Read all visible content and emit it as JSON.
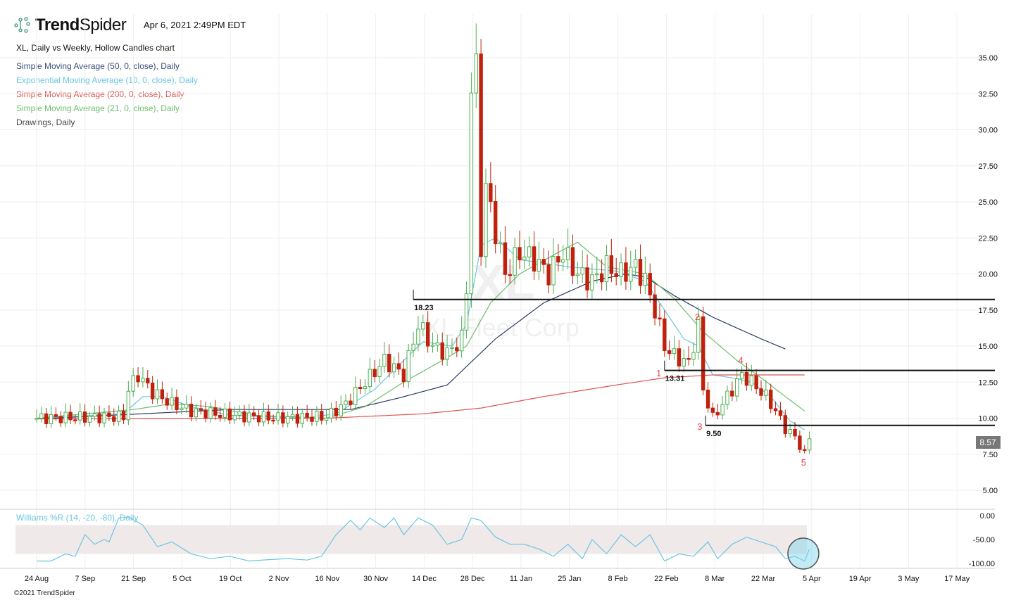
{
  "header": {
    "brand_bold": "Trend",
    "brand_light": "Spider",
    "timestamp": "Apr 6, 2021 2:49PM EDT",
    "chart_title": "XL, Daily vs Weekly, Hollow Candles chart",
    "footer": "©2021 TrendSpider"
  },
  "legend": [
    {
      "label": "Simple Moving Average (50, 0, close), Daily",
      "color": "#3a4f7a"
    },
    {
      "label": "Exponential Moving Average (10, 0, close), Daily",
      "color": "#6cc6e0"
    },
    {
      "label": "Simple Moving Average (200, 0, close), Daily",
      "color": "#d9534f"
    },
    {
      "label": "Simple Moving Average (21, 0, close), Daily",
      "color": "#6cbf6c"
    },
    {
      "label": "Drawings, Daily",
      "color": "#444444"
    }
  ],
  "watermark": {
    "symbol": "XL",
    "name": "XL Fleet Corp"
  },
  "chart_data": {
    "type": "candlestick",
    "ylim": [
      5,
      35
    ],
    "yticks": [
      "35.00",
      "32.50",
      "30.00",
      "27.50",
      "25.00",
      "22.50",
      "20.00",
      "17.50",
      "15.00",
      "12.50",
      "10.00",
      "7.50",
      "5.00"
    ],
    "xticks": [
      "24 Aug",
      "7 Sep",
      "21 Sep",
      "5 Oct",
      "19 Oct",
      "2 Nov",
      "16 Nov",
      "30 Nov",
      "14 Dec",
      "28 Dec",
      "11 Jan",
      "25 Jan",
      "8 Feb",
      "22 Feb",
      "8 Mar",
      "22 Mar",
      "5 Apr",
      "19 Apr",
      "3 May",
      "17 May"
    ],
    "last_price": "8.57",
    "close_path": [
      [
        0,
        10
      ],
      [
        18,
        10.1
      ],
      [
        19,
        12
      ],
      [
        21,
        13
      ],
      [
        24,
        11.8
      ],
      [
        28,
        11
      ],
      [
        32,
        10.5
      ],
      [
        40,
        10.2
      ],
      [
        50,
        10
      ],
      [
        60,
        10.1
      ],
      [
        64,
        11
      ],
      [
        68,
        12.5
      ],
      [
        72,
        14
      ],
      [
        76,
        13
      ],
      [
        79,
        16.5
      ],
      [
        82,
        15
      ],
      [
        85,
        14.5
      ],
      [
        88,
        15.5
      ],
      [
        89,
        19
      ],
      [
        90,
        33
      ],
      [
        91,
        34
      ],
      [
        92,
        22
      ],
      [
        93,
        26
      ],
      [
        95,
        23
      ],
      [
        97,
        20
      ],
      [
        100,
        21.5
      ],
      [
        103,
        21
      ],
      [
        106,
        20
      ],
      [
        109,
        21.5
      ],
      [
        112,
        20
      ],
      [
        115,
        19.5
      ],
      [
        118,
        20.5
      ],
      [
        121,
        20
      ],
      [
        124,
        20.5
      ],
      [
        126,
        19.5
      ],
      [
        128,
        17.5
      ],
      [
        130,
        15
      ],
      [
        132,
        14.3
      ],
      [
        135,
        13.8
      ],
      [
        137,
        16.5
      ],
      [
        138,
        12
      ],
      [
        140,
        10
      ],
      [
        143,
        11.5
      ],
      [
        146,
        13
      ],
      [
        148,
        12.5
      ],
      [
        151,
        11.5
      ],
      [
        153,
        10.5
      ],
      [
        155,
        9.3
      ],
      [
        157,
        8.7
      ],
      [
        159,
        7.5
      ],
      [
        160,
        8.57
      ]
    ],
    "series": [
      {
        "name": "SMA 50",
        "color": "#2a3a66",
        "points": [
          [
            0,
            9.95
          ],
          [
            40,
            10.6
          ],
          [
            65,
            10.6
          ],
          [
            75,
            11.4
          ],
          [
            85,
            12.3
          ],
          [
            95,
            15.5
          ],
          [
            105,
            18
          ],
          [
            115,
            19.5
          ],
          [
            122,
            20
          ],
          [
            126,
            19.8
          ],
          [
            132,
            18.5
          ],
          [
            140,
            17
          ],
          [
            150,
            15.5
          ],
          [
            155,
            14.8
          ]
        ]
      },
      {
        "name": "EMA 10",
        "color": "#6cc6e0",
        "points": [
          [
            0,
            10
          ],
          [
            18,
            10.3
          ],
          [
            22,
            11.5
          ],
          [
            26,
            11.5
          ],
          [
            32,
            10.8
          ],
          [
            40,
            10.2
          ],
          [
            55,
            10
          ],
          [
            62,
            10.3
          ],
          [
            70,
            12
          ],
          [
            76,
            14
          ],
          [
            80,
            15.3
          ],
          [
            86,
            15
          ],
          [
            89,
            16.5
          ],
          [
            92,
            22
          ],
          [
            95,
            22.5
          ],
          [
            100,
            21
          ],
          [
            110,
            20.5
          ],
          [
            120,
            20.2
          ],
          [
            126,
            19.5
          ],
          [
            130,
            17.5
          ],
          [
            134,
            15.5
          ],
          [
            137,
            15
          ],
          [
            140,
            13
          ],
          [
            144,
            12.8
          ],
          [
            148,
            12.5
          ],
          [
            152,
            11.5
          ],
          [
            156,
            9.8
          ],
          [
            159,
            9.2
          ]
        ]
      },
      {
        "name": "SMA 200",
        "color": "#d9534f",
        "points": [
          [
            0,
            9.95
          ],
          [
            60,
            10.0
          ],
          [
            80,
            10.3
          ],
          [
            92,
            10.7
          ],
          [
            105,
            11.5
          ],
          [
            120,
            12.3
          ],
          [
            130,
            12.8
          ],
          [
            140,
            13.0
          ],
          [
            159,
            13.0
          ]
        ]
      },
      {
        "name": "SMA 21",
        "color": "#6cbf6c",
        "points": [
          [
            0,
            10
          ],
          [
            20,
            10.6
          ],
          [
            28,
            11
          ],
          [
            36,
            10.8
          ],
          [
            45,
            10.2
          ],
          [
            60,
            10
          ],
          [
            68,
            10.8
          ],
          [
            76,
            12.5
          ],
          [
            84,
            14
          ],
          [
            89,
            15
          ],
          [
            94,
            18
          ],
          [
            100,
            20
          ],
          [
            108,
            21.5
          ],
          [
            112,
            22.2
          ],
          [
            118,
            20.5
          ],
          [
            126,
            20
          ],
          [
            132,
            18.3
          ],
          [
            138,
            16
          ],
          [
            145,
            14
          ],
          [
            150,
            12.8
          ],
          [
            155,
            11.5
          ],
          [
            159,
            10.5
          ]
        ]
      }
    ],
    "levels": [
      {
        "value": 18.23,
        "label": "18.23",
        "from_day": 78
      },
      {
        "value": 13.31,
        "label": "13.31",
        "from_day": 130
      },
      {
        "value": 9.5,
        "label": "9.50",
        "from_day": 138.5
      }
    ],
    "waves": [
      {
        "label": "1",
        "day": 129,
        "price": 12.9
      },
      {
        "label": "2",
        "day": 137,
        "price": 16.8
      },
      {
        "label": "3",
        "day": 137.5,
        "price": 9.2
      },
      {
        "label": "4",
        "day": 146,
        "price": 13.8
      },
      {
        "label": "5",
        "day": 159,
        "price": 6.7
      }
    ],
    "williams_r": {
      "label": "Williams %R (14, -20, -80), Daily",
      "yticks": [
        "0.00",
        "-50.00",
        "-100.00"
      ],
      "ylim": [
        -100,
        0
      ],
      "points": [
        [
          0,
          -95
        ],
        [
          3,
          -95
        ],
        [
          6,
          -80
        ],
        [
          8,
          -85
        ],
        [
          10,
          -40
        ],
        [
          12,
          -60
        ],
        [
          14,
          -50
        ],
        [
          15,
          -55
        ],
        [
          17,
          -5
        ],
        [
          19,
          -3
        ],
        [
          22,
          -20
        ],
        [
          25,
          -65
        ],
        [
          28,
          -55
        ],
        [
          32,
          -80
        ],
        [
          36,
          -90
        ],
        [
          40,
          -85
        ],
        [
          44,
          -95
        ],
        [
          48,
          -92
        ],
        [
          52,
          -90
        ],
        [
          56,
          -93
        ],
        [
          59,
          -85
        ],
        [
          62,
          -40
        ],
        [
          65,
          -10
        ],
        [
          67,
          -30
        ],
        [
          69,
          -5
        ],
        [
          72,
          -25
        ],
        [
          74,
          -5
        ],
        [
          76,
          -40
        ],
        [
          79,
          -5
        ],
        [
          82,
          -20
        ],
        [
          85,
          -60
        ],
        [
          88,
          -50
        ],
        [
          90,
          -5
        ],
        [
          92,
          -10
        ],
        [
          95,
          -45
        ],
        [
          98,
          -60
        ],
        [
          101,
          -60
        ],
        [
          104,
          -70
        ],
        [
          107,
          -85
        ],
        [
          110,
          -60
        ],
        [
          113,
          -90
        ],
        [
          115,
          -50
        ],
        [
          118,
          -80
        ],
        [
          121,
          -40
        ],
        [
          124,
          -65
        ],
        [
          127,
          -40
        ],
        [
          130,
          -95
        ],
        [
          133,
          -80
        ],
        [
          136,
          -85
        ],
        [
          139,
          -55
        ],
        [
          141,
          -90
        ],
        [
          144,
          -60
        ],
        [
          147,
          -45
        ],
        [
          150,
          -55
        ],
        [
          153,
          -65
        ],
        [
          155,
          -90
        ],
        [
          157,
          -85
        ],
        [
          159,
          -95
        ],
        [
          160,
          -70
        ]
      ]
    }
  }
}
